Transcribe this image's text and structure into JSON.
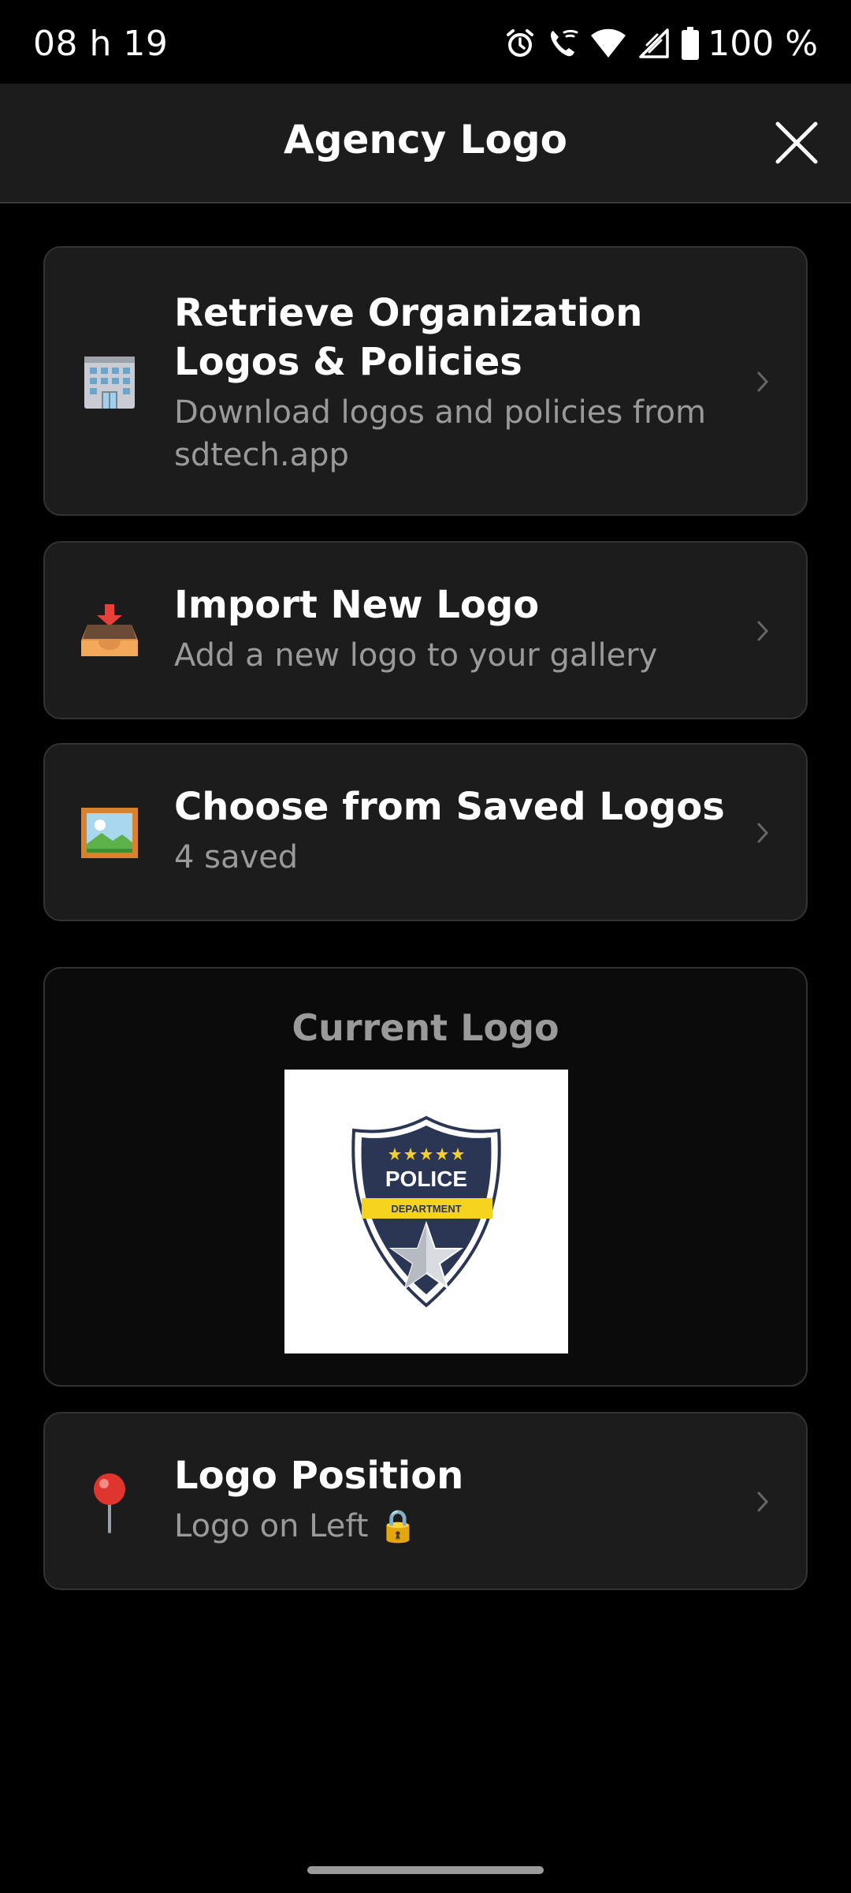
{
  "status": {
    "time": "08 h 19",
    "battery_text": "100 %"
  },
  "header": {
    "title": "Agency Logo",
    "close_icon": "close-icon"
  },
  "options": [
    {
      "title": "Retrieve Organization Logos & Policies",
      "subtitle": "Download logos and policies from sdtech.app",
      "icon": "office-building-icon"
    },
    {
      "title": "Import New Logo",
      "subtitle": "Add a new logo to your gallery",
      "icon": "inbox-tray-icon"
    },
    {
      "title": "Choose from Saved Logos",
      "subtitle": "4 saved",
      "icon": "framed-picture-icon"
    }
  ],
  "current_logo": {
    "label": "Current Logo",
    "badge_top": "POLICE",
    "badge_band": "DEPARTMENT"
  },
  "position": {
    "title": "Logo Position",
    "subtitle": "Logo on Left 🔒",
    "icon": "round-pushpin-icon"
  },
  "colors": {
    "background": "#000000",
    "card": "#1c1c1c",
    "subtitle": "#9a9a9a",
    "badge_navy": "#2b3654",
    "badge_yellow": "#f5d21b"
  }
}
